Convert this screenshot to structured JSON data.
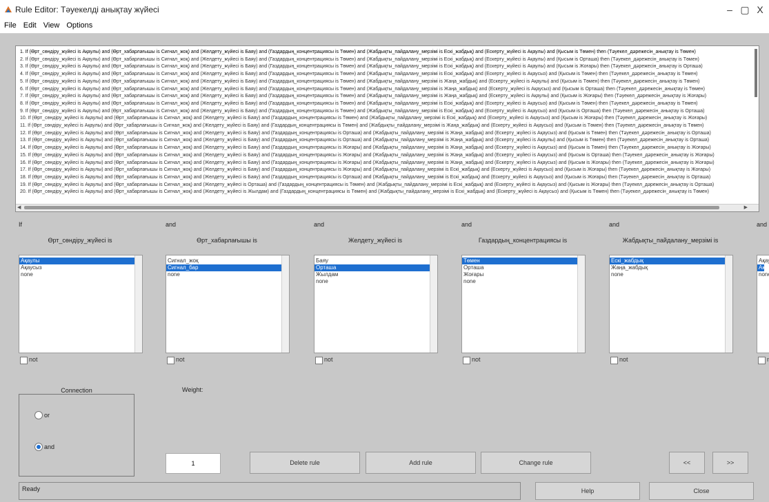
{
  "window": {
    "title": "Rule Editor: Тәуекелді анықтау жүйесі",
    "minimize": "–",
    "maximize": "▢",
    "close": "X"
  },
  "menu": [
    "File",
    "Edit",
    "View",
    "Options"
  ],
  "rules": [
    "1. If (Өрт_сөндіру_жүйесі is Ақаулы) and (Өрт_хабарлағышы is Сигнал_жоқ) and (Желдету_жүйесі is Баяу) and (Газдардың_концентрациясы is Төмен) and (Жабдықты_пайдалану_мерзімі is Ескі_жабдық) and (Ескерту_жүйесі is Ақаулы) and (Қысым is Төмен) then (Тәуекел_дәрежесін_анықтау is Төмен)",
    "2. If (Өрт_сөндіру_жүйесі is Ақаулы) and (Өрт_хабарлағышы is Сигнал_жоқ) and (Желдету_жүйесі is Баяу) and (Газдардың_концентрациясы is Төмен) and (Жабдықты_пайдалану_мерзімі is Ескі_жабдық) and (Ескерту_жүйесі is Ақаулы) and (Қысым is Орташа) then (Тәуекел_дәрежесін_анықтау is Төмен)",
    "3. If (Өрт_сөндіру_жүйесі is Ақаулы) and (Өрт_хабарлағышы is Сигнал_жоқ) and (Желдету_жүйесі is Баяу) and (Газдардың_концентрациясы is Төмен) and (Жабдықты_пайдалану_мерзімі is Ескі_жабдық) and (Ескерту_жүйесі is Ақаулы) and (Қысым is Жоғары) then (Тәуекел_дәрежесін_анықтау is Орташа)",
    "4. If (Өрт_сөндіру_жүйесі is Ақаулы) and (Өрт_хабарлағышы is Сигнал_жоқ) and (Желдету_жүйесі is Баяу) and (Газдардың_концентрациясы is Төмен) and (Жабдықты_пайдалану_мерзімі is Ескі_жабдық) and (Ескерту_жүйесі is Ақаусыз) and (Қысым is Төмен) then (Тәуекел_дәрежесін_анықтау is Төмен)",
    "5. If (Өрт_сөндіру_жүйесі is Ақаулы) and (Өрт_хабарлағышы is Сигнал_жоқ) and (Желдету_жүйесі is Баяу) and (Газдардың_концентрациясы is Төмен) and (Жабдықты_пайдалану_мерзімі is Жаңа_жабдық) and (Ескерту_жүйесі is Ақаулы) and (Қысым is Төмен) then (Тәуекел_дәрежесін_анықтау is Төмен)",
    "6. If (Өрт_сөндіру_жүйесі is Ақаулы) and (Өрт_хабарлағышы is Сигнал_жоқ) and (Желдету_жүйесі is Баяу) and (Газдардың_концентрациясы is Төмен) and (Жабдықты_пайдалану_мерзімі is Жаңа_жабдық) and (Ескерту_жүйесі is Ақаусыз) and (Қысым is Орташа) then (Тәуекел_дәрежесін_анықтау is Төмен)",
    "7. If (Өрт_сөндіру_жүйесі is Ақаулы) and (Өрт_хабарлағышы is Сигнал_жоқ) and (Желдету_жүйесі is Баяу) and (Газдардың_концентрациясы is Төмен) and (Жабдықты_пайдалану_мерзімі is Жаңа_жабдық) and (Ескерту_жүйесі is Ақаулы) and (Қысым is Жоғары) then (Тәуекел_дәрежесін_анықтау is Жоғары)",
    "8. If (Өрт_сөндіру_жүйесі is Ақаулы) and (Өрт_хабарлағышы is Сигнал_жоқ) and (Желдету_жүйесі is Баяу) and (Газдардың_концентрациясы is Төмен) and (Жабдықты_пайдалану_мерзімі is Ескі_жабдық) and (Ескерту_жүйесі is Ақаусыз) and (Қысым is Төмен) then (Тәуекел_дәрежесін_анықтау is Төмен)",
    "9. If (Өрт_сөндіру_жүйесі is Ақаулы) and (Өрт_хабарлағышы is Сигнал_жоқ) and (Желдету_жүйесі is Баяу) and (Газдардың_концентрациясы is Төмен) and (Жабдықты_пайдалану_мерзімі is Ескі_жабдық) and (Ескерту_жүйесі is Ақаусыз) and (Қысым is Орташа) then (Тәуекел_дәрежесін_анықтау is Орташа)",
    "10. If (Өрт_сөндіру_жүйесі is Ақаулы) and (Өрт_хабарлағышы is Сигнал_жоқ) and (Желдету_жүйесі is Баяу) and (Газдардың_концентрациясы is Төмен) and (Жабдықты_пайдалану_мерзімі is Ескі_жабдық) and (Ескерту_жүйесі is Ақаусыз) and (Қысым is Жоғары) then (Тәуекел_дәрежесін_анықтау is Жоғары)",
    "11. If (Өрт_сөндіру_жүйесі is Ақаулы) and (Өрт_хабарлағышы is Сигнал_жоқ) and (Желдету_жүйесі is Баяу) and (Газдардың_концентрациясы is Төмен) and (Жабдықты_пайдалану_мерзімі is Жаңа_жабдық) and (Ескерту_жүйесі is Ақаусыз) and (Қысым is Төмен) then (Тәуекел_дәрежесін_анықтау is Төмен)",
    "12. If (Өрт_сөндіру_жүйесі is Ақаулы) and (Өрт_хабарлағышы is Сигнал_жоқ) and (Желдету_жүйесі is Баяу) and (Газдардың_концентрациясы is Орташа) and (Жабдықты_пайдалану_мерзімі is Жаңа_жабдық) and (Ескерту_жүйесі is Ақаусыз) and (Қысым is Төмен) then (Тәуекел_дәрежесін_анықтау is Орташа)",
    "13. If (Өрт_сөндіру_жүйесі is Ақаулы) and (Өрт_хабарлағышы is Сигнал_жоқ) and (Желдету_жүйесі is Баяу) and (Газдардың_концентрациясы is Орташа) and (Жабдықты_пайдалану_мерзімі is Жаңа_жабдық) and (Ескерту_жүйесі is Ақаулы) and (Қысым is Төмен) then (Тәуекел_дәрежесін_анықтау is Орташа)",
    "14. If (Өрт_сөндіру_жүйесі is Ақаулы) and (Өрт_хабарлағышы is Сигнал_жоқ) and (Желдету_жүйесі is Баяу) and (Газдардың_концентрациясы is Жоғары) and (Жабдықты_пайдалану_мерзімі is Жаңа_жабдық) and (Ескерту_жүйесі is Ақаусыз) and (Қысым is Төмен) then (Тәуекел_дәрежесін_анықтау is Жоғары)",
    "15. If (Өрт_сөндіру_жүйесі is Ақаулы) and (Өрт_хабарлағышы is Сигнал_жоқ) and (Желдету_жүйесі is Баяу) and (Газдардың_концентрациясы is Жоғары) and (Жабдықты_пайдалану_мерзімі is Жаңа_жабдық) and (Ескерту_жүйесі is Ақаусыз) and (Қысым is Орташа) then (Тәуекел_дәрежесін_анықтау is Жоғары)",
    "16. If (Өрт_сөндіру_жүйесі is Ақаулы) and (Өрт_хабарлағышы is Сигнал_жоқ) and (Желдету_жүйесі is Баяу) and (Газдардың_концентрациясы is Жоғары) and (Жабдықты_пайдалану_мерзімі is Жаңа_жабдық) and (Ескерту_жүйесі is Ақаусыз) and (Қысым is Жоғары) then (Тәуекел_дәрежесін_анықтау is Жоғары)",
    "17. If (Өрт_сөндіру_жүйесі is Ақаулы) and (Өрт_хабарлағышы is Сигнал_жоқ) and (Желдету_жүйесі is Баяу) and (Газдардың_концентрациясы is Жоғары) and (Жабдықты_пайдалану_мерзімі is Ескі_жабдық) and (Ескерту_жүйесі is Ақаусыз) and (Қысым is Жоғары) then (Тәуекел_дәрежесін_анықтау is Жоғары)",
    "18. If (Өрт_сөндіру_жүйесі is Ақаулы) and (Өрт_хабарлағышы is Сигнал_жоқ) and (Желдету_жүйесі is Баяу) and (Газдардың_концентрациясы is Орташа) and (Жабдықты_пайдалану_мерзімі is Ескі_жабдық) and (Ескерту_жүйесі is Ақаусыз) and (Қысым is Жоғары) then (Тәуекел_дәрежесін_анықтау is Орташа)",
    "19. If (Өрт_сөндіру_жүйесі is Ақаулы) and (Өрт_хабарлағышы is Сигнал_жоқ) and (Желдету_жүйесі is Орташа) and (Газдардың_концентрациясы is Төмен) and (Жабдықты_пайдалану_мерзімі is Ескі_жабдық) and (Ескерту_жүйесі is Ақаусыз) and (Қысым is Жоғары) then (Тәуекел_дәрежесін_анықтау is Орташа)",
    "20. If (Өрт_сөндіру_жүйесі is Ақаулы) and (Өрт_хабарлағышы is Сигнал_жоқ) and (Желдету_жүйесі is Жылдам) and (Газдардың_концентрациясы is Төмен) and (Жабдықты_пайдалану_мерзімі is Ескі_жабдық) and (Ескерту_жүйесі is Ақаусыз) and (Қысым is Төмен) then (Тәуекел_дәрежесін_анықтау is Төмен)"
  ],
  "inputs": [
    {
      "connector": "If",
      "name": "Өрт_сөндіру_жүйесі is",
      "options": [
        "Ақаулы",
        "Ақаусыз",
        "none"
      ],
      "selected": 0,
      "not": "not"
    },
    {
      "connector": "and",
      "name": "Өрт_хабарлағышы is",
      "options": [
        "Сигнал_жоқ",
        "Сигнал_бар",
        "none"
      ],
      "selected": 1,
      "not": "not"
    },
    {
      "connector": "and",
      "name": "Желдету_жүйесі is",
      "options": [
        "Баяу",
        "Орташа",
        "Жылдам",
        "none"
      ],
      "selected": 1,
      "not": "not"
    },
    {
      "connector": "and",
      "name": "Газдардың_концентрациясы is",
      "options": [
        "Төмен",
        "Орташа",
        "Жоғары",
        "none"
      ],
      "selected": 0,
      "not": "not"
    },
    {
      "connector": "and",
      "name": "Жабдықты_пайдалану_мерзімі is",
      "options": [
        "Ескі_жабдық",
        "Жаңа_жабдық",
        "none"
      ],
      "selected": 0,
      "not": "not"
    },
    {
      "connector": "and",
      "name": "",
      "options": [
        "Ақау",
        "Ақау",
        "none"
      ],
      "selected": 1,
      "not": "no"
    }
  ],
  "connection": {
    "title": "Connection",
    "or_label": "or",
    "and_label": "and",
    "selected": "and"
  },
  "weight": {
    "label": "Weight:",
    "value": "1"
  },
  "buttons": {
    "delete": "Delete rule",
    "add": "Add rule",
    "change": "Change rule",
    "prev": "<<",
    "next": ">>",
    "help": "Help",
    "close": "Close"
  },
  "status": "Ready"
}
